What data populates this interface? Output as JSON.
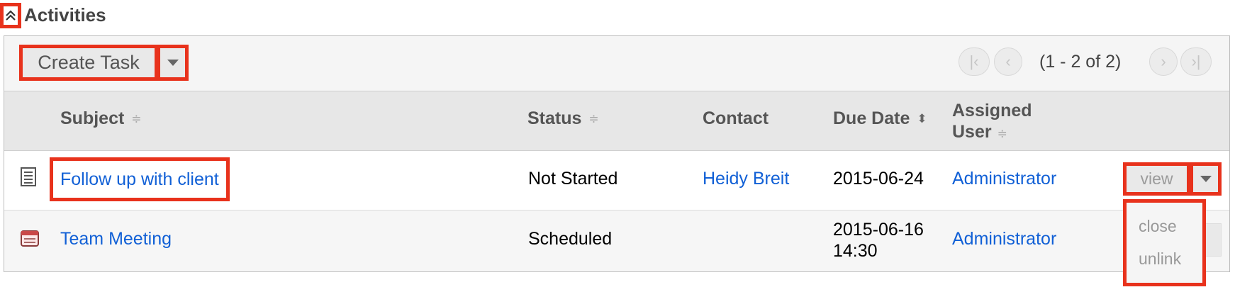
{
  "section": {
    "title": "Activities",
    "collapse_icon": "double-chevron-up-icon"
  },
  "toolbar": {
    "create_label": "Create Task",
    "pagination": {
      "info": "(1 - 2 of 2)"
    }
  },
  "columns": {
    "subject": "Subject",
    "status": "Status",
    "contact": "Contact",
    "due_date": "Due Date",
    "assigned_line1": "Assigned",
    "assigned_line2": "User"
  },
  "rows": [
    {
      "icon": "task-icon",
      "subject": "Follow up with client",
      "status": "Not Started",
      "contact": "Heidy Breit",
      "due_date": "2015-06-24",
      "assigned": "Administrator",
      "action": "view"
    },
    {
      "icon": "calendar-meeting-icon",
      "subject": "Team Meeting",
      "status": "Scheduled",
      "contact": "",
      "due_date_line1": "2015-06-16",
      "due_date_line2": "14:30",
      "assigned": "Administrator"
    }
  ],
  "action_menu": {
    "items": [
      "close",
      "unlink"
    ]
  },
  "colors": {
    "highlight": "#e8321c",
    "link": "#1160d6"
  }
}
